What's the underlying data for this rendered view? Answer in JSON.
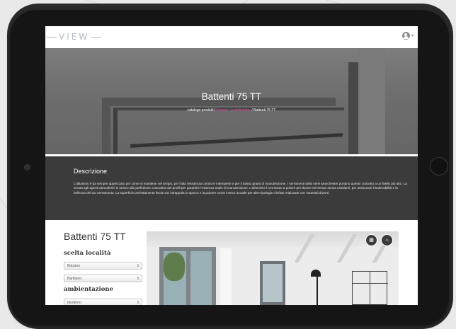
{
  "colors": {
    "accent_pink": "#e0539c",
    "desc_bg": "#3b3b3b",
    "header_bg": "#ffffff"
  },
  "header": {
    "logo_text": "VIEW",
    "user_icon": "user-circle-icon"
  },
  "hero": {
    "title": "Battenti 75 TT",
    "breadcrumb": {
      "part1": "catalogo prodotti / ",
      "part2": "finestre / portefinestre",
      "part3": " / Battenti 75 TT"
    }
  },
  "description": {
    "title": "Descrizione",
    "text": "L'alluminio è da sempre apprezzato per come si mantiene nel tempo, per l'alta resistenza contro le intemperie e per il basso grado di manutenzione. I serramenti della serie Manchester portano questo concetto a un livello più alto. La tenuta agli agenti atmosferici si unisce alla perfezione costruttiva dei profili per garantire l'essenza totale di manutenzione. L'alluminio è verniciato a polveri per durare nel tempo senza ossidarsi, per assicurarti l'inalterabilità e la bellezza del tuo serramento. La superficie perfettamente liscia non intrappola lo sporco e la polvere come invece accade per altre tipologie d'infissi realizzate con materiali diversi."
  },
  "panel": {
    "product_title": "Battenti 75 TT",
    "location_label": "scelta località",
    "location_select1": "Bolzano",
    "location_select2": "Barbiano",
    "env_label": "ambientazione",
    "env_select": "moderno"
  },
  "preview_buttons": [
    {
      "icon": "gallery-icon"
    },
    {
      "icon": "home-icon"
    }
  ]
}
